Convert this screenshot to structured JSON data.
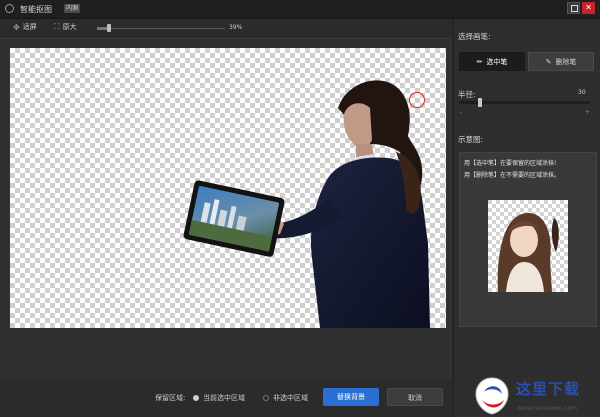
{
  "window": {
    "title": "智能抠图",
    "badge": "内测",
    "close_glyph": "✕"
  },
  "toolbar": {
    "fit_label": "适屏",
    "actual_label": "原大",
    "zoom_percent": 39,
    "zoom_text": "39%"
  },
  "side_panel": {
    "select_brush_title": "选择画笔:",
    "select_brush_label": "选中笔",
    "erase_brush_label": "删除笔",
    "radius_title": "半径:",
    "radius_value": "30",
    "radius_min_symbol": "-",
    "radius_max_symbol": "+",
    "example_title": "示意图:",
    "example_line1": "用【选中笔】在要保留的区域涂抹!",
    "example_line2": "用【删除笔】在不需要的区域涂抹。"
  },
  "bottom_bar": {
    "keep_area_label": "保留区域:",
    "option_current": "当前选中区域",
    "option_inverse": "非选中区域",
    "selected_option": "当前选中区域",
    "replace_bg_label": "替换背景",
    "cancel_label": "取消"
  },
  "watermark": {
    "text": "这里下载",
    "url": "www.herecown.com"
  },
  "colors": {
    "accent": "#2a6fd3",
    "close": "#c7232a",
    "brush_ring": "#e02020"
  }
}
